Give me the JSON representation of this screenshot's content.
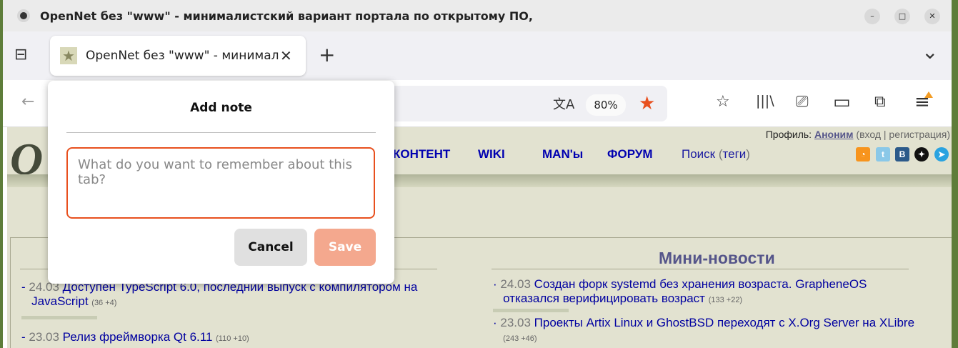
{
  "window": {
    "title": "OpenNet без \"www\" - минималистский вариант портала по открытому ПО,",
    "minimize": "–",
    "maximize": "□",
    "close": "✕"
  },
  "tab": {
    "title": "OpenNet без \"www\" - минималистский вариант",
    "close": "✕",
    "new_tab": "+",
    "list_all": "⌄"
  },
  "toolbar": {
    "back": "←",
    "translate": "文A",
    "zoom": "80%",
    "bookmark_star": "★",
    "save_pocket": "☆",
    "library": "|||\\",
    "sync": "⎚",
    "sidebar": "▭",
    "extensions": "⧉",
    "menu": "≡"
  },
  "page": {
    "profile_label": "Профиль:",
    "profile_user": "Аноним",
    "login": "вход",
    "register": "регистрация",
    "nav": [
      "КОНТЕНТ",
      "WIKI",
      "MAN'ы",
      "ФОРУМ"
    ],
    "search": "Поиск",
    "tags": "теги",
    "mini_news_title": "Мини-новости",
    "news_left": [
      {
        "date": "24.03",
        "title": "Доступен TypeScript 6.0, последний выпуск с компилятором на",
        "title2": "JavaScript",
        "count": "(36 +4)"
      },
      {
        "date": "23.03",
        "title": "Релиз фреймворка Qt 6.11",
        "count": "(110 +10)"
      }
    ],
    "news_right": [
      {
        "date": "24.03",
        "title": "Создан форк systemd без хранения возраста. GrapheneOS",
        "title2": "отказался верифицировать возраст",
        "count": "(133 +22)"
      },
      {
        "date": "23.03",
        "title": "Проекты Artix Linux и GhostBSD переходят с X.Org Server на XLibre",
        "count": "(243 +46)"
      }
    ],
    "logo": "O"
  },
  "note_popup": {
    "title": "Add note",
    "placeholder": "What do you want to remember about this tab?",
    "cancel": "Cancel",
    "save": "Save"
  },
  "colors": {
    "accent": "#e8501e",
    "save_disabled": "#f4a88e",
    "page_bg": "#e2e2d0",
    "link": "#0000a0"
  }
}
